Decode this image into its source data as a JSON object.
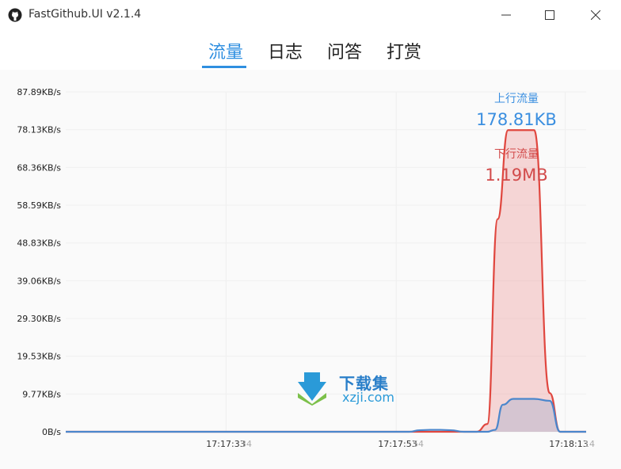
{
  "window": {
    "title": "FastGithub.UI v2.1.4"
  },
  "tabs": [
    {
      "label": "流量",
      "active": true
    },
    {
      "label": "日志",
      "active": false
    },
    {
      "label": "问答",
      "active": false
    },
    {
      "label": "打赏",
      "active": false
    }
  ],
  "stats": {
    "upload_label": "上行流量",
    "upload_value": "178.81KB",
    "upload_color": "#3b8fe0",
    "download_label": "下行流量",
    "download_value": "1.19MB",
    "download_color": "#d24a4a"
  },
  "watermark": {
    "cn": "下载集",
    "url": "xzji.com"
  },
  "chart_data": {
    "type": "area",
    "y_ticks": [
      "87.89KB/s",
      "78.13KB/s",
      "68.36KB/s",
      "58.59KB/s",
      "48.83KB/s",
      "39.06KB/s",
      "29.30KB/s",
      "19.53KB/s",
      "9.77KB/s",
      "0B/s"
    ],
    "x_ticks": [
      "17:17:33",
      "17:17:53",
      "17:18:13"
    ],
    "x_ticks_overlap": [
      "34",
      "54",
      "14"
    ],
    "ylim": [
      0,
      87.89
    ],
    "series": [
      {
        "name": "下行流量",
        "color": "#e0473f",
        "fill": "rgba(232,120,120,0.28)",
        "x": [
          0,
          0.5,
          0.64,
          0.7,
          0.72,
          0.74,
          0.765,
          0.79,
          0.81,
          0.83,
          0.85,
          0.87,
          0.88,
          0.9,
          0.93,
          0.95,
          1.0
        ],
        "values": [
          0,
          0,
          0,
          0,
          0,
          0,
          0,
          0,
          2,
          55,
          78,
          78,
          78,
          78,
          10,
          0,
          0
        ]
      },
      {
        "name": "上行流量",
        "color": "#4a86cc",
        "fill": "rgba(120,150,200,0.25)",
        "x": [
          0,
          0.66,
          0.68,
          0.7,
          0.72,
          0.74,
          0.765,
          0.79,
          0.81,
          0.825,
          0.84,
          0.86,
          0.9,
          0.93,
          0.95,
          1.0
        ],
        "values": [
          0,
          0,
          0.4,
          0.5,
          0.5,
          0.4,
          0,
          0,
          0,
          0.5,
          7,
          8.5,
          8.5,
          8,
          0,
          0
        ]
      }
    ],
    "grid": true
  }
}
